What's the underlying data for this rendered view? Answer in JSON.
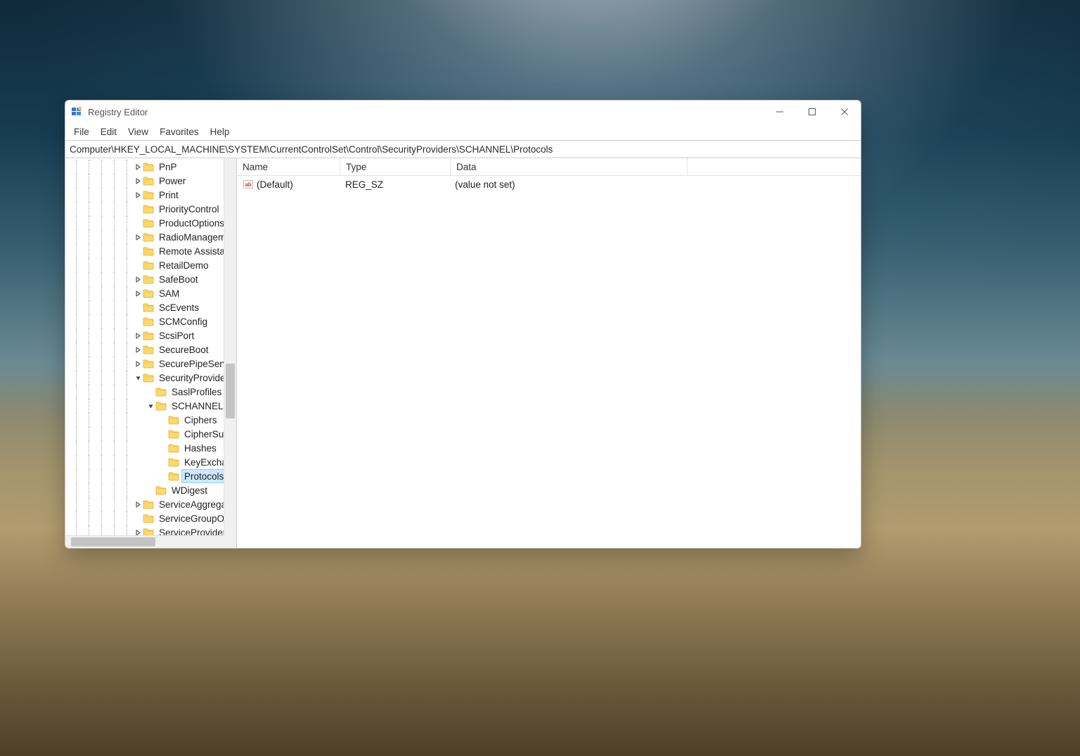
{
  "window": {
    "title": "Registry Editor"
  },
  "menu": {
    "file": "File",
    "edit": "Edit",
    "view": "View",
    "favorites": "Favorites",
    "help": "Help"
  },
  "address": "Computer\\HKEY_LOCAL_MACHINE\\SYSTEM\\CurrentControlSet\\Control\\SecurityProviders\\SCHANNEL\\Protocols",
  "tree_ancestor_lines": [
    15,
    33,
    51,
    69,
    87
  ],
  "tree": [
    {
      "depth": 5,
      "exp": "collapsed",
      "label": "PnP"
    },
    {
      "depth": 5,
      "exp": "collapsed",
      "label": "Power"
    },
    {
      "depth": 5,
      "exp": "collapsed",
      "label": "Print"
    },
    {
      "depth": 5,
      "exp": "none",
      "label": "PriorityControl"
    },
    {
      "depth": 5,
      "exp": "none",
      "label": "ProductOptions"
    },
    {
      "depth": 5,
      "exp": "collapsed",
      "label": "RadioManagement"
    },
    {
      "depth": 5,
      "exp": "none",
      "label": "Remote Assistance"
    },
    {
      "depth": 5,
      "exp": "none",
      "label": "RetailDemo"
    },
    {
      "depth": 5,
      "exp": "collapsed",
      "label": "SafeBoot"
    },
    {
      "depth": 5,
      "exp": "collapsed",
      "label": "SAM"
    },
    {
      "depth": 5,
      "exp": "none",
      "label": "ScEvents"
    },
    {
      "depth": 5,
      "exp": "none",
      "label": "SCMConfig"
    },
    {
      "depth": 5,
      "exp": "collapsed",
      "label": "ScsiPort"
    },
    {
      "depth": 5,
      "exp": "collapsed",
      "label": "SecureBoot"
    },
    {
      "depth": 5,
      "exp": "collapsed",
      "label": "SecurePipeServers"
    },
    {
      "depth": 5,
      "exp": "expanded",
      "label": "SecurityProviders"
    },
    {
      "depth": 6,
      "exp": "none",
      "label": "SaslProfiles"
    },
    {
      "depth": 6,
      "exp": "expanded",
      "label": "SCHANNEL"
    },
    {
      "depth": 7,
      "exp": "none",
      "label": "Ciphers"
    },
    {
      "depth": 7,
      "exp": "none",
      "label": "CipherSuites"
    },
    {
      "depth": 7,
      "exp": "none",
      "label": "Hashes"
    },
    {
      "depth": 7,
      "exp": "none",
      "label": "KeyExchangeAlgorithms"
    },
    {
      "depth": 7,
      "exp": "none",
      "label": "Protocols",
      "selected": true
    },
    {
      "depth": 6,
      "exp": "none",
      "label": "WDigest"
    },
    {
      "depth": 5,
      "exp": "collapsed",
      "label": "ServiceAggregatedEvents"
    },
    {
      "depth": 5,
      "exp": "none",
      "label": "ServiceGroupOrder"
    },
    {
      "depth": 5,
      "exp": "collapsed",
      "label": "ServiceProvider"
    }
  ],
  "list": {
    "headers": {
      "name": "Name",
      "type": "Type",
      "data": "Data"
    },
    "rows": [
      {
        "name": "(Default)",
        "type": "REG_SZ",
        "data": "(value not set)",
        "icon": "string"
      }
    ]
  }
}
